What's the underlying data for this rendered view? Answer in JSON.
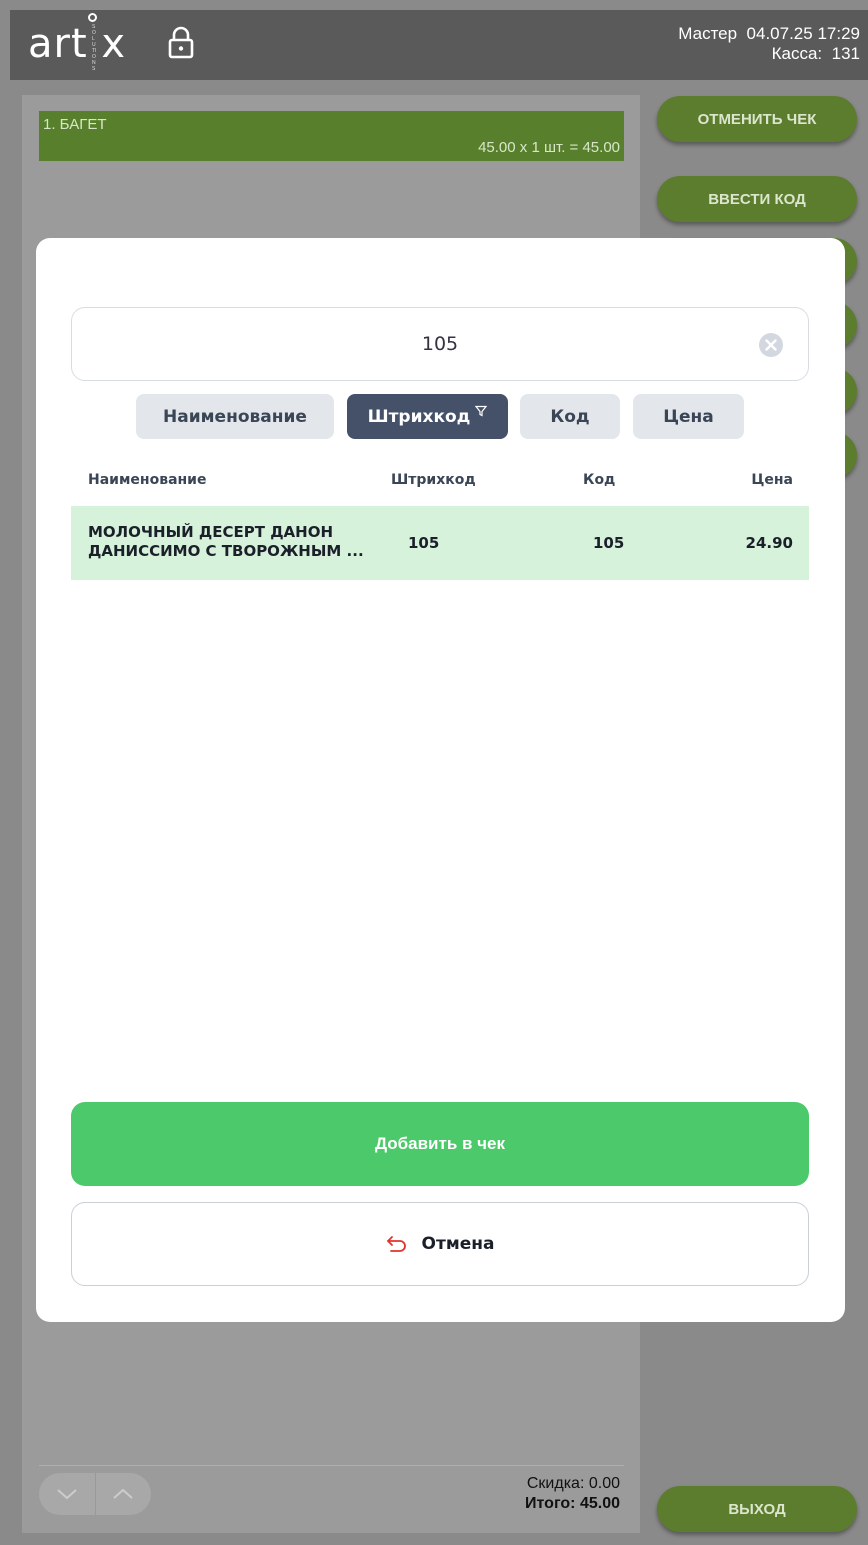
{
  "header": {
    "logo": "art x",
    "logo_vertical": "SOLUTIONS",
    "user": "Мастер",
    "date": "04.07.25",
    "time": "17:29",
    "register_label": "Касса:",
    "register_number": "131"
  },
  "receipt": {
    "items": [
      {
        "name": "1. БАГЕТ",
        "calc": "45.00 х 1 шт. = 45.00"
      }
    ],
    "discount_label": "Скидка:",
    "discount_value": "0.00",
    "total_label": "Итого:",
    "total_value": "45.00"
  },
  "right_buttons": {
    "cancel_check": "ОТМЕНИТЬ ЧЕК",
    "enter_code": "ВВЕСТИ КОД",
    "exit": "ВЫХОД"
  },
  "modal": {
    "search_value": "105",
    "filters": [
      {
        "label": "Наименование",
        "active": false
      },
      {
        "label": "Штрихкод",
        "active": true
      },
      {
        "label": "Код",
        "active": false
      },
      {
        "label": "Цена",
        "active": false
      }
    ],
    "columns": [
      "Наименование",
      "Штрихкод",
      "Код",
      "Цена"
    ],
    "rows": [
      {
        "name": "МОЛОЧНЫЙ ДЕСЕРТ ДАНОН ДАНИССИМО С ТВОРОЖНЫМ ...",
        "barcode": "105",
        "code": "105",
        "price": "24.90"
      }
    ],
    "add_button": "Добавить в чек",
    "cancel_button": "Отмена"
  },
  "colors": {
    "accent_green": "#4cc96a",
    "olive": "#5c7c2e",
    "active_chip": "#445168",
    "selected_row": "#d6f2da",
    "cancel_icon": "#e0342c"
  }
}
